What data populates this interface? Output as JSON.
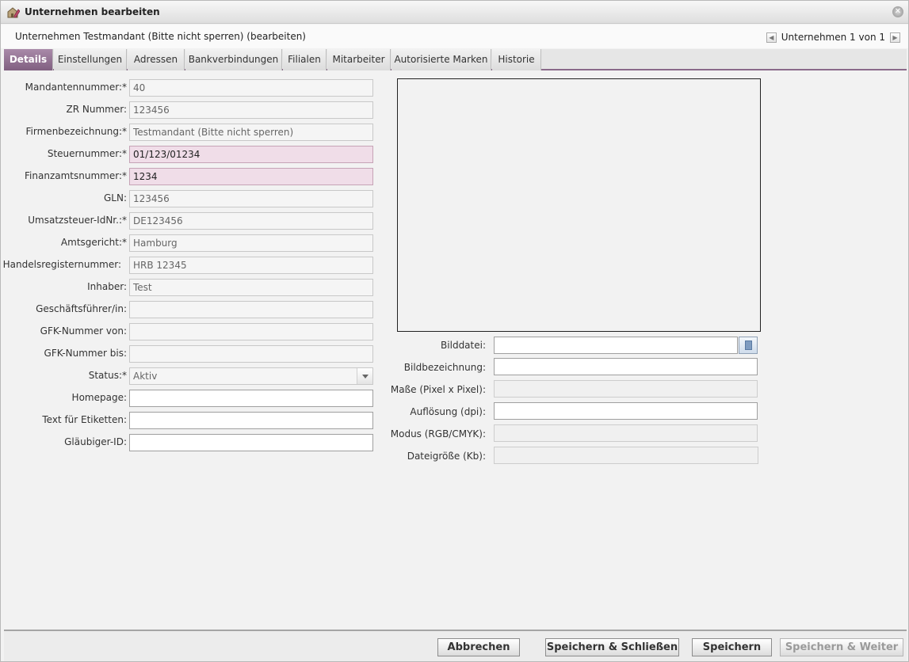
{
  "window": {
    "title": "Unternehmen bearbeiten",
    "subtitle": "Unternehmen Testmandant (Bitte nicht sperren) (bearbeiten)",
    "pager_text": "Unternehmen 1 von 1"
  },
  "tabs": [
    {
      "label": "Details",
      "active": true
    },
    {
      "label": "Einstellungen",
      "active": false
    },
    {
      "label": "Adressen",
      "active": false
    },
    {
      "label": "Bankverbindungen",
      "active": false
    },
    {
      "label": "Filialen",
      "active": false
    },
    {
      "label": "Mitarbeiter",
      "active": false
    },
    {
      "label": "Autorisierte Marken",
      "active": false
    },
    {
      "label": "Historie",
      "active": false
    }
  ],
  "form": {
    "mandantennummer": {
      "label": "Mandantennummer:*",
      "value": "40"
    },
    "zr_nummer": {
      "label": "ZR Nummer:",
      "value": "123456"
    },
    "firmenbezeichnung": {
      "label": "Firmenbezeichnung:*",
      "value": "Testmandant (Bitte nicht sperren)"
    },
    "steuernummer": {
      "label": "Steuernummer:*",
      "value": "01/123/01234"
    },
    "finanzamtsnummer": {
      "label": "Finanzamtsnummer:*",
      "value": "1234"
    },
    "gln": {
      "label": "GLN:",
      "value": "123456"
    },
    "ust_idnr": {
      "label": "Umsatzsteuer-IdNr.:*",
      "value": "DE123456"
    },
    "amtsgericht": {
      "label": "Amtsgericht:*",
      "value": "Hamburg"
    },
    "handelsregisternummer": {
      "label": "Handelsregisternummer:",
      "value": "HRB 12345"
    },
    "inhaber": {
      "label": "Inhaber:",
      "value": "Test"
    },
    "geschaeftsfuehrer": {
      "label": "Geschäftsführer/in:",
      "value": ""
    },
    "gfk_von": {
      "label": "GFK-Nummer von:",
      "value": ""
    },
    "gfk_bis": {
      "label": "GFK-Nummer bis:",
      "value": ""
    },
    "status": {
      "label": "Status:*",
      "value": "Aktiv"
    },
    "homepage": {
      "label": "Homepage:",
      "value": ""
    },
    "text_etiketten": {
      "label": "Text für Etiketten:",
      "value": ""
    },
    "glaeubiger_id": {
      "label": "Gläubiger-ID:",
      "value": ""
    }
  },
  "image": {
    "bilddatei": {
      "label": "Bilddatei:",
      "value": ""
    },
    "bildbezeichnung": {
      "label": "Bildbezeichnung:",
      "value": ""
    },
    "masse": {
      "label": "Maße (Pixel x Pixel):",
      "value": ""
    },
    "aufloesung": {
      "label": "Auflösung (dpi):",
      "value": ""
    },
    "modus": {
      "label": "Modus (RGB/CMYK):",
      "value": ""
    },
    "dateigroesse": {
      "label": "Dateigröße (Kb):",
      "value": ""
    }
  },
  "buttons": {
    "abbrechen": "Abbrechen",
    "speichern_schliessen": "Speichern & Schließen",
    "speichern": "Speichern",
    "speichern_weiter": "Speichern & Weiter"
  },
  "icons": {
    "app": "building-edit-icon",
    "close": "close-icon",
    "prev": "arrow-left-icon",
    "next": "arrow-right-icon",
    "browse": "file-browse-icon",
    "dropdown": "chevron-down-icon"
  },
  "colors": {
    "tab_active": "#8a6a8a",
    "required_invalid": "#f0dde8"
  }
}
